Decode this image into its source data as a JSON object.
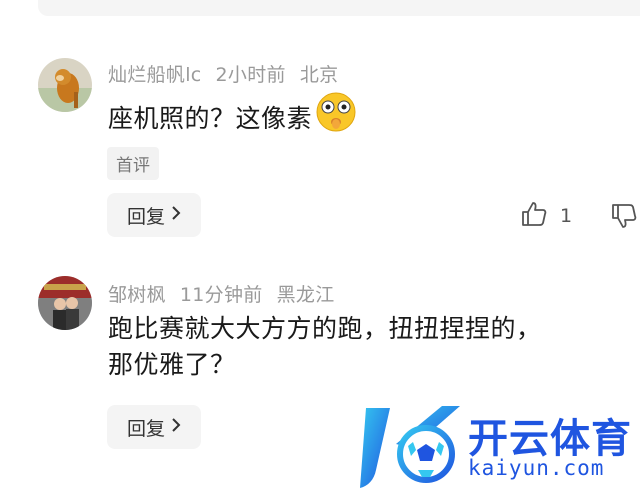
{
  "comments": [
    {
      "username": "灿烂船帆lc",
      "time": "2小时前",
      "location": "北京",
      "text": "座机照的？这像素",
      "tag": "首评",
      "reply_label": "回复",
      "like_count": "1"
    },
    {
      "username": "邹树枫",
      "time": "11分钟前",
      "location": "黑龙江",
      "text_line1": "跑比赛就大大方方的跑，扭扭捏捏的，",
      "text_line2": "那优雅了？",
      "reply_label": "回复"
    }
  ],
  "watermark": {
    "cn": "开云体育",
    "en": "kaiyun.com",
    "color": "#1f55e0"
  },
  "icons": [
    "thumbs-up-icon",
    "thumbs-down-icon",
    "chevron-right-icon",
    "emoji-icon"
  ]
}
